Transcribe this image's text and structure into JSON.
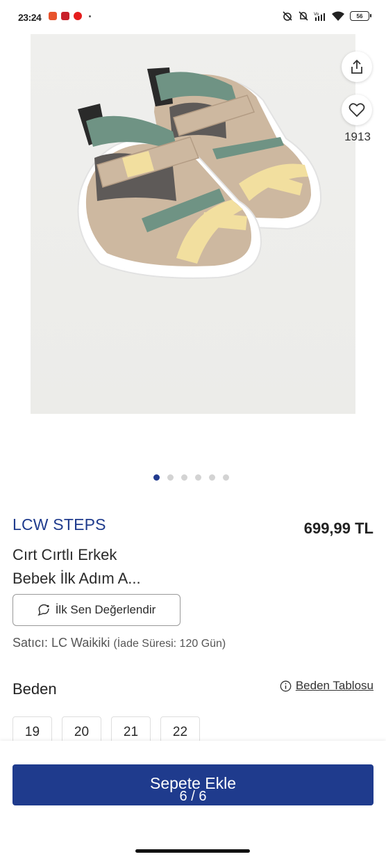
{
  "status_bar": {
    "time": "23:24",
    "battery": "56"
  },
  "product_image": {
    "favorites_count": "1913",
    "carousel": {
      "total_dots": 6,
      "active_index": 0
    }
  },
  "product": {
    "brand": "LCW STEPS",
    "price": "699,99 TL",
    "name_line1": "Cırt Cırtlı Erkek",
    "name_line2": "Bebek İlk Adım A..."
  },
  "review_button": {
    "label": "İlk Sen Değerlendir"
  },
  "seller": {
    "label": "Satıcı: LC Waikiki",
    "note": "(İade Süresi: 120 Gün)"
  },
  "sizes": {
    "title": "Beden",
    "table_link": "Beden Tablosu",
    "options": [
      "19",
      "20",
      "21",
      "22"
    ]
  },
  "cart_button": {
    "label": "Sepete Ekle",
    "counter": "6 / 6"
  },
  "colors": {
    "brand_blue": "#1f3b8d",
    "dot_active": "#223b8f",
    "dot_inactive": "#d3d3d3"
  }
}
